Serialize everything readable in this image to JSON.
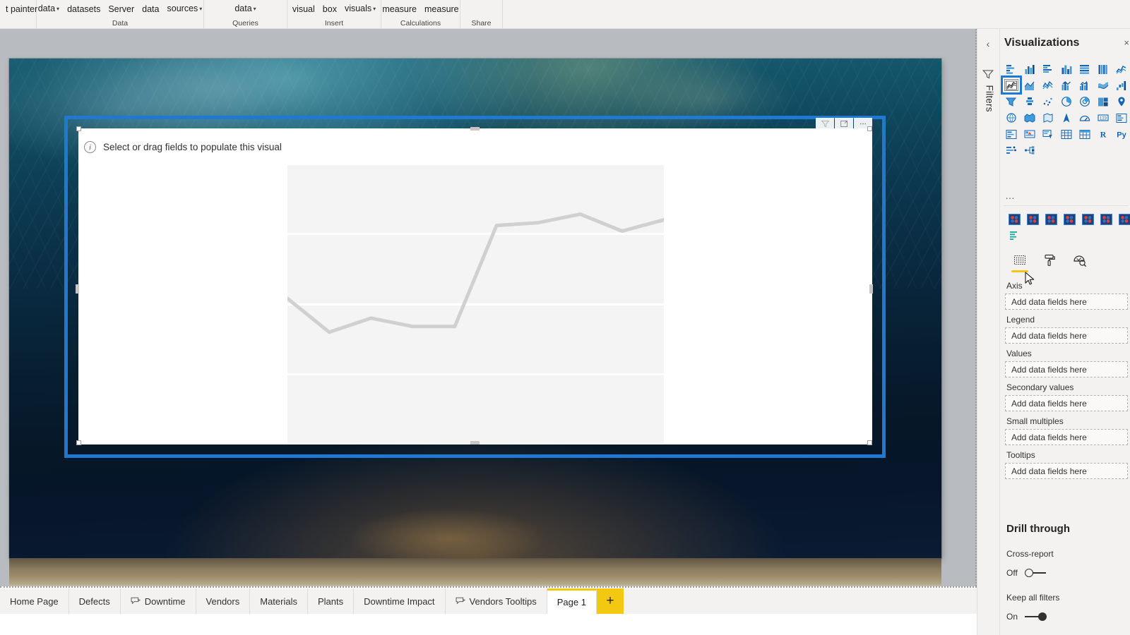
{
  "ribbon": {
    "groups": [
      {
        "label": "",
        "items": [
          {
            "text": "t painter",
            "caret": false
          }
        ]
      },
      {
        "label": "Data",
        "items": [
          {
            "text": "data",
            "caret": true
          },
          {
            "text": "datasets",
            "caret": false
          },
          {
            "text": "Server",
            "caret": false
          },
          {
            "text": "data",
            "caret": false
          },
          {
            "text": "sources",
            "caret": true
          }
        ]
      },
      {
        "label": "Queries",
        "items": [
          {
            "text": "data",
            "caret": true
          }
        ]
      },
      {
        "label": "Insert",
        "items": [
          {
            "text": "visual",
            "caret": false
          },
          {
            "text": "box",
            "caret": false
          },
          {
            "text": "visuals",
            "caret": true
          }
        ]
      },
      {
        "label": "Calculations",
        "items": [
          {
            "text": "measure",
            "caret": false
          },
          {
            "text": "measure",
            "caret": false
          }
        ]
      },
      {
        "label": "Share",
        "items": []
      }
    ]
  },
  "visual": {
    "placeholder_message": "Select or drag fields to populate this visual",
    "info_glyph": "i",
    "header_buttons": [
      {
        "name": "filter-icon",
        "title": "Filters"
      },
      {
        "name": "focus-mode-icon",
        "title": "Focus mode"
      },
      {
        "name": "more-options-icon",
        "title": "More options"
      }
    ]
  },
  "chart_data": {
    "type": "line",
    "title": "",
    "subtitle": "",
    "xlabel": "",
    "ylabel": "",
    "grid": true,
    "legend": "none",
    "note": "Greyed-out placeholder line chart shown in empty Power BI line visual",
    "x": [
      0,
      1,
      2,
      3,
      4,
      5,
      6,
      7,
      8,
      9
    ],
    "series": [
      {
        "name": "placeholder",
        "color": "#d0d0d0",
        "values": [
          52,
          40,
          45,
          42,
          42,
          78,
          79,
          82,
          76,
          80
        ]
      }
    ],
    "ylim": [
      0,
      100
    ],
    "xlim": [
      0,
      9
    ],
    "gridline_count": 4
  },
  "right_pane": {
    "filters_rail": {
      "collapse_chevron": "‹",
      "label": "Filters",
      "funnel_icon": "filter-icon"
    },
    "title": "Visualizations",
    "close_glyph": "×",
    "visual_types": [
      {
        "name": "stacked-bar-chart",
        "selected": false
      },
      {
        "name": "stacked-column-chart",
        "selected": false
      },
      {
        "name": "clustered-bar-chart",
        "selected": false
      },
      {
        "name": "clustered-column-chart",
        "selected": false
      },
      {
        "name": "100-stacked-bar-chart",
        "selected": false
      },
      {
        "name": "100-stacked-column-chart",
        "selected": false
      },
      {
        "name": "line-chart-alt",
        "selected": false
      },
      {
        "name": "line-chart",
        "selected": true
      },
      {
        "name": "area-chart",
        "selected": false
      },
      {
        "name": "stacked-area-chart",
        "selected": false
      },
      {
        "name": "line-stacked-column-chart",
        "selected": false
      },
      {
        "name": "line-clustered-column-chart",
        "selected": false
      },
      {
        "name": "ribbon-chart",
        "selected": false
      },
      {
        "name": "waterfall-chart",
        "selected": false
      },
      {
        "name": "funnel-chart",
        "selected": false
      },
      {
        "name": "scatter-chart",
        "selected": false
      },
      {
        "name": "pie-chart",
        "selected": false
      },
      {
        "name": "donut-chart",
        "selected": false
      },
      {
        "name": "treemap-chart",
        "selected": false
      },
      {
        "name": "map-visual",
        "selected": false
      },
      {
        "name": "filled-map-visual",
        "selected": false
      },
      {
        "name": "shape-map-visual",
        "selected": false
      },
      {
        "name": "azure-map-visual",
        "selected": false
      },
      {
        "name": "gauge-visual",
        "selected": false
      },
      {
        "name": "card-visual",
        "selected": false
      },
      {
        "name": "multi-row-card-visual",
        "selected": false
      },
      {
        "name": "kpi-visual",
        "selected": false
      },
      {
        "name": "slicer-visual",
        "selected": false
      },
      {
        "name": "table-visual",
        "selected": false
      },
      {
        "name": "matrix-visual",
        "selected": false
      },
      {
        "name": "r-script-visual",
        "selected": false
      },
      {
        "name": "python-visual",
        "selected": false
      },
      {
        "name": "key-influencers-visual",
        "selected": false
      },
      {
        "name": "decomposition-tree-visual",
        "selected": false
      },
      {
        "name": "qna-visual",
        "selected": false
      },
      {
        "name": "smart-narrative-visual",
        "selected": false
      },
      {
        "name": "paginated-report-visual",
        "selected": false
      }
    ],
    "more_visuals_glyph": "…",
    "custom_visuals_count": 7,
    "pane_tabs": [
      {
        "name": "tab-fields",
        "title": "Fields",
        "active": true
      },
      {
        "name": "tab-format",
        "title": "Format",
        "active": false
      },
      {
        "name": "tab-analytics",
        "title": "Analytics",
        "active": false
      }
    ],
    "wells": [
      {
        "label": "Axis",
        "placeholder": "Add data fields here"
      },
      {
        "label": "Legend",
        "placeholder": "Add data fields here"
      },
      {
        "label": "Values",
        "placeholder": "Add data fields here"
      },
      {
        "label": "Secondary values",
        "placeholder": "Add data fields here"
      },
      {
        "label": "Small multiples",
        "placeholder": "Add data fields here"
      },
      {
        "label": "Tooltips",
        "placeholder": "Add data fields here"
      }
    ],
    "drill_through": {
      "title": "Drill through",
      "cross_report": {
        "label": "Cross-report",
        "state": "Off"
      },
      "keep_all_filters": {
        "label": "Keep all filters",
        "state": "On"
      }
    }
  },
  "page_tabs": {
    "items": [
      {
        "label": "Home Page",
        "tooltip_page": false,
        "active": false
      },
      {
        "label": "Defects",
        "tooltip_page": false,
        "active": false
      },
      {
        "label": "Downtime",
        "tooltip_page": true,
        "active": false
      },
      {
        "label": "Vendors",
        "tooltip_page": false,
        "active": false
      },
      {
        "label": "Materials",
        "tooltip_page": false,
        "active": false
      },
      {
        "label": "Plants",
        "tooltip_page": false,
        "active": false
      },
      {
        "label": "Downtime Impact",
        "tooltip_page": false,
        "active": false
      },
      {
        "label": "Vendors Tooltips",
        "tooltip_page": true,
        "active": false
      },
      {
        "label": "Page 1",
        "tooltip_page": false,
        "active": true
      }
    ],
    "add_page_glyph": "+"
  },
  "colors": {
    "accent_yellow": "#f2c811",
    "selection_blue": "#1f78d1",
    "pane_bg": "#f3f2f1",
    "placeholder_line": "#d0d0d0"
  }
}
